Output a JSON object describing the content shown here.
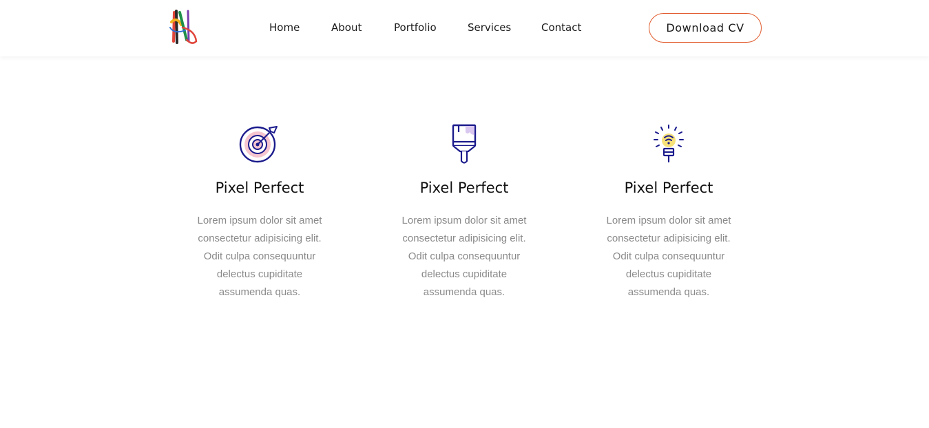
{
  "nav": {
    "links": [
      "Home",
      "About",
      "Portfolio",
      "Services",
      "Contact"
    ],
    "cta_label": "Download CV",
    "accent_color": "#e05a2b"
  },
  "features": [
    {
      "icon": "target-icon",
      "title": "Pixel Perfect",
      "text": "Lorem ipsum dolor sit amet consectetur adipisicing elit. Odit culpa consequuntur delectus cupiditate assumenda quas."
    },
    {
      "icon": "paint-brush-icon",
      "title": "Pixel Perfect",
      "text": "Lorem ipsum dolor sit amet consectetur adipisicing elit. Odit culpa consequuntur delectus cupiditate assumenda quas."
    },
    {
      "icon": "light-bulb-icon",
      "title": "Pixel Perfect",
      "text": "Lorem ipsum dolor sit amet consectetur adipisicing elit. Odit culpa consequuntur delectus cupiditate assumenda quas."
    }
  ]
}
